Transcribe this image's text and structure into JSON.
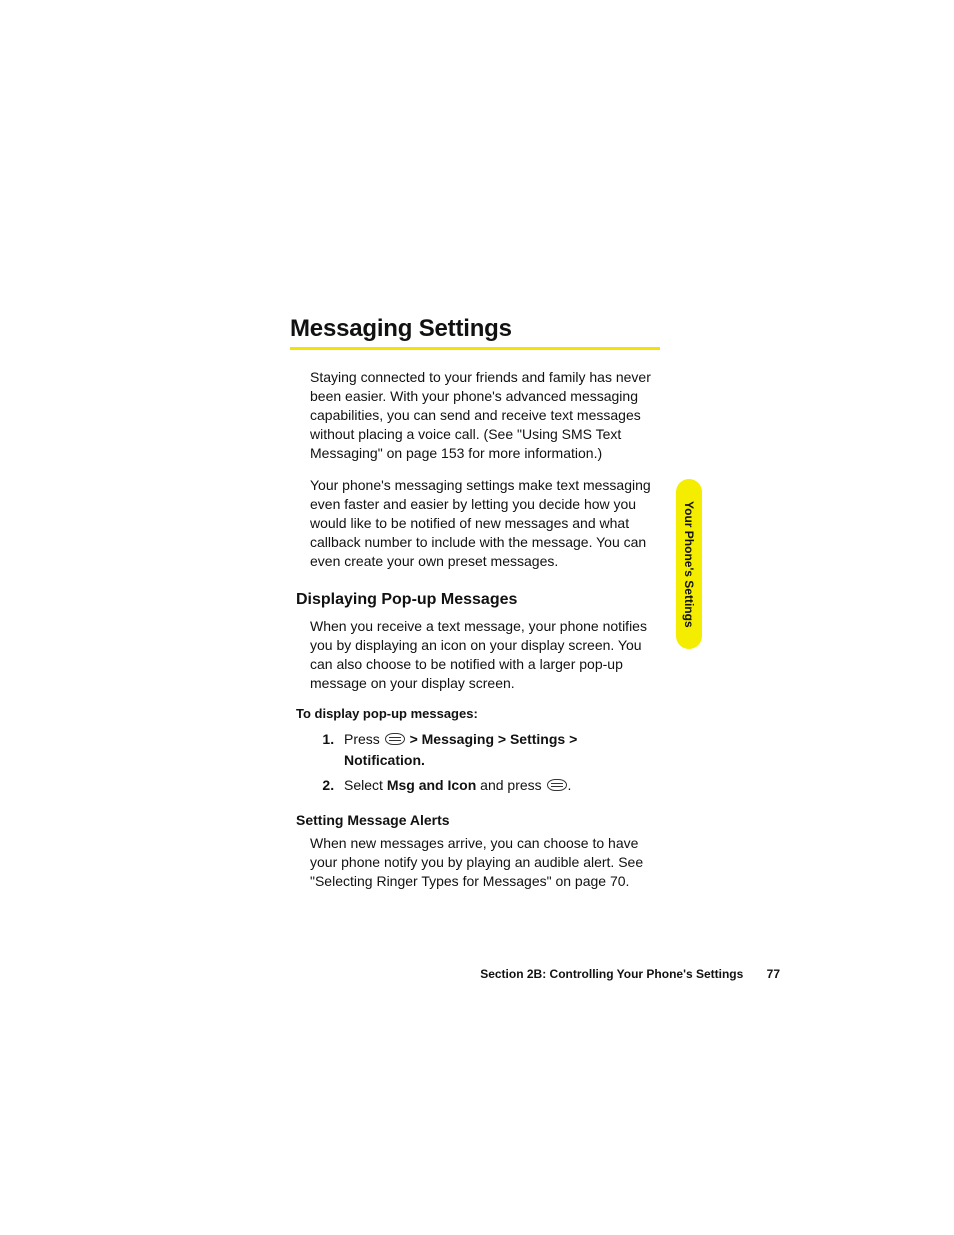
{
  "title": "Messaging Settings",
  "para1": "Staying connected to your friends and family has never been easier. With your phone's advanced messaging capabilities, you can send and receive text messages without placing a voice call. (See \"Using SMS Text Messaging\" on page 153 for more information.)",
  "para2": "Your phone's messaging settings make text messaging even faster and easier by letting you decide how you would like to be notified of new messages and what callback number to include with the message. You can even create your own preset messages.",
  "subhead1": "Displaying Pop-up Messages",
  "para3": "When you receive a text message, your phone notifies you by displaying an icon on your display screen. You can also choose to be notified with a larger pop-up message on your display screen.",
  "instrLead": "To display pop-up messages:",
  "step1": {
    "pre": "Press ",
    "path": " > Messaging > Settings > Notification."
  },
  "step2": {
    "pre": "Select ",
    "bold": "Msg and Icon",
    "mid": " and press ",
    "end": "."
  },
  "subhead2": "Setting Message Alerts",
  "para4": "When new messages arrive, you can choose to have your phone notify you by playing an audible alert. See \"Selecting Ringer Types for Messages\" on page 70.",
  "sideTab": "Your Phone's Settings",
  "footer": {
    "label": "Section 2B: Controlling Your Phone's Settings",
    "page": "77"
  }
}
